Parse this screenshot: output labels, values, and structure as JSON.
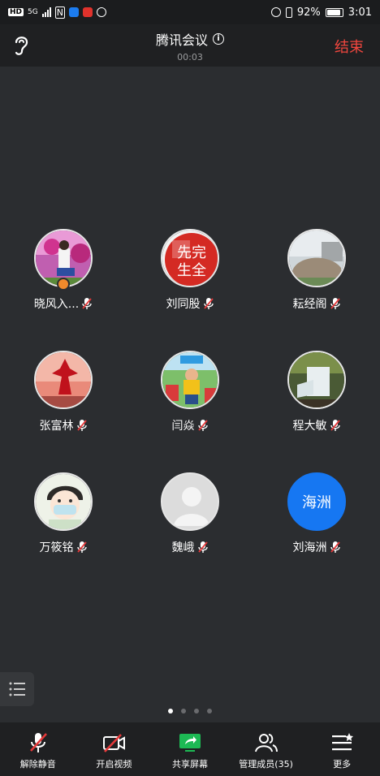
{
  "status_bar": {
    "network": "5G",
    "battery": "92%",
    "time": "3:01"
  },
  "header": {
    "title": "腾讯会议",
    "timer": "00:03",
    "end_label": "结束"
  },
  "participants": [
    {
      "name": "晓风入...",
      "avatar": "photo-flowers",
      "is_host": true
    },
    {
      "name": "刘同股",
      "avatar": "photo-red-seal"
    },
    {
      "name": "耘经阁",
      "avatar": "photo-stone"
    },
    {
      "name": "张富林",
      "avatar": "photo-sunset"
    },
    {
      "name": "闫焱",
      "avatar": "photo-child"
    },
    {
      "name": "程大敏",
      "avatar": "photo-waterfall"
    },
    {
      "name": "万筱铭",
      "avatar": "cartoon-boy"
    },
    {
      "name": "魏峨",
      "avatar": "default-person"
    },
    {
      "name": "刘海洲",
      "avatar": "text",
      "avatar_text": "海洲",
      "avatar_color": "#1677f2"
    }
  ],
  "pager": {
    "count": 4,
    "active": 0
  },
  "toolbar": {
    "unmute": "解除静音",
    "video": "开启视频",
    "share": "共享屏幕",
    "members": "管理成员(35)",
    "more": "更多"
  },
  "colors": {
    "end": "#f0463e",
    "share": "#1db954",
    "avatar_blue": "#1677f2",
    "mute_red": "#e5393a"
  }
}
